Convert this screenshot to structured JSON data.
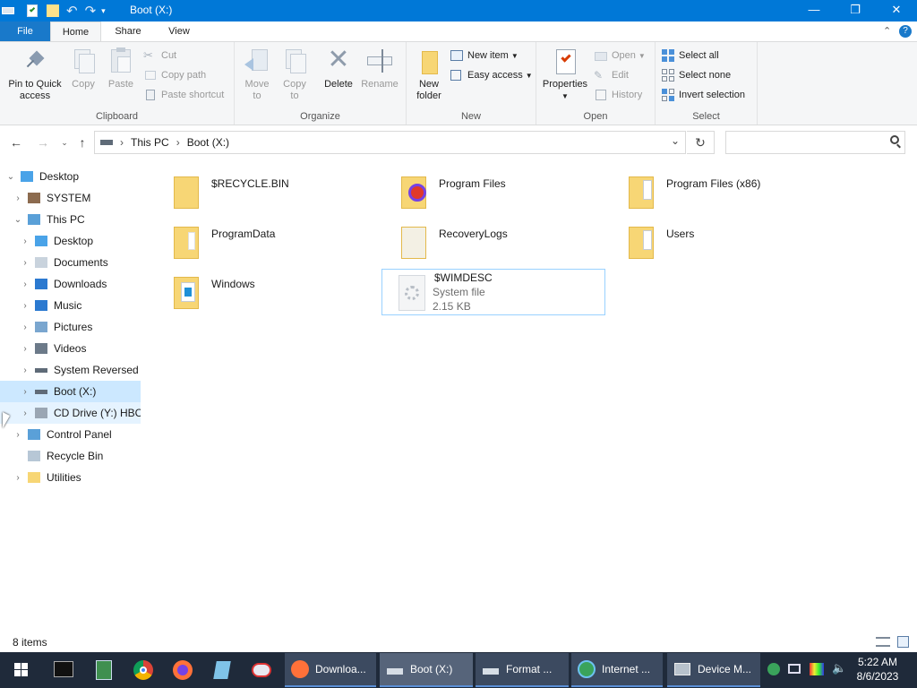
{
  "window": {
    "title": "Boot (X:)",
    "min_glyph": "—",
    "max_glyph": "❐",
    "close_glyph": "✕"
  },
  "ribbon_tabs": [
    "File",
    "Home",
    "Share",
    "View"
  ],
  "ribbon": {
    "clipboard": {
      "label": "Clipboard",
      "pin": "Pin to Quick access",
      "copy": "Copy",
      "paste": "Paste",
      "cut": "Cut",
      "copy_path": "Copy path",
      "paste_shortcut": "Paste shortcut"
    },
    "organize": {
      "label": "Organize",
      "move_to": "Move to",
      "copy_to": "Copy to",
      "delete": "Delete",
      "rename": "Rename"
    },
    "new": {
      "label": "New",
      "new_folder": "New folder",
      "new_item": "New item",
      "easy_access": "Easy access"
    },
    "open": {
      "label": "Open",
      "properties": "Properties",
      "open": "Open",
      "edit": "Edit",
      "history": "History"
    },
    "select": {
      "label": "Select",
      "select_all": "Select all",
      "select_none": "Select none",
      "invert": "Invert selection"
    }
  },
  "address": {
    "crumbs": [
      "This PC",
      "Boot (X:)"
    ],
    "separator": "›",
    "search_placeholder": ""
  },
  "tree": [
    {
      "label": "Desktop",
      "level": 0,
      "expander": "⌄",
      "icon": "desktop-icon"
    },
    {
      "label": "SYSTEM",
      "level": 1,
      "expander": "›",
      "icon": "user-icon"
    },
    {
      "label": "This PC",
      "level": 1,
      "expander": "⌄",
      "icon": "pc-icon"
    },
    {
      "label": "Desktop",
      "level": 2,
      "expander": "›",
      "icon": "desktop-icon"
    },
    {
      "label": "Documents",
      "level": 2,
      "expander": "›",
      "icon": "documents-icon"
    },
    {
      "label": "Downloads",
      "level": 2,
      "expander": "›",
      "icon": "downloads-icon"
    },
    {
      "label": "Music",
      "level": 2,
      "expander": "›",
      "icon": "music-icon"
    },
    {
      "label": "Pictures",
      "level": 2,
      "expander": "›",
      "icon": "pictures-icon"
    },
    {
      "label": "Videos",
      "level": 2,
      "expander": "›",
      "icon": "videos-icon"
    },
    {
      "label": "System Reversed (",
      "level": 2,
      "expander": "›",
      "icon": "drive-icon"
    },
    {
      "label": "Boot (X:)",
      "level": 2,
      "expander": "›",
      "icon": "drive-icon"
    },
    {
      "label": "CD Drive (Y:) HBC",
      "level": 2,
      "expander": "›",
      "icon": "cd-drive-icon"
    },
    {
      "label": "Control Panel",
      "level": 1,
      "expander": "›",
      "icon": "control-panel-icon"
    },
    {
      "label": "Recycle Bin",
      "level": 1,
      "expander": "",
      "icon": "recycle-bin-icon"
    },
    {
      "label": "Utilities",
      "level": 1,
      "expander": "›",
      "icon": "folder-icon"
    }
  ],
  "files": [
    {
      "name": "$RECYCLE.BIN",
      "type": "folder-faded"
    },
    {
      "name": "Program Files",
      "type": "folder-app"
    },
    {
      "name": "Program Files (x86)",
      "type": "folder-docs"
    },
    {
      "name": "ProgramData",
      "type": "folder-faded"
    },
    {
      "name": "RecoveryLogs",
      "type": "folder-faded-white"
    },
    {
      "name": "Users",
      "type": "folder-docs"
    },
    {
      "name": "Windows",
      "type": "folder-win"
    },
    {
      "name": "$WIMDESC",
      "type": "system-file",
      "subtype": "System file",
      "size": "2.15 KB"
    }
  ],
  "status": {
    "count": "8 items"
  },
  "taskbar": {
    "tasks": [
      "Downloa...",
      "Boot (X:)",
      "Format ...",
      "Internet ...",
      "Device M..."
    ],
    "time": "5:22 AM",
    "date": "8/6/2023"
  },
  "colors": {
    "accent": "#0078d7",
    "selection": "#cce8ff",
    "folder": "#f7d675"
  }
}
